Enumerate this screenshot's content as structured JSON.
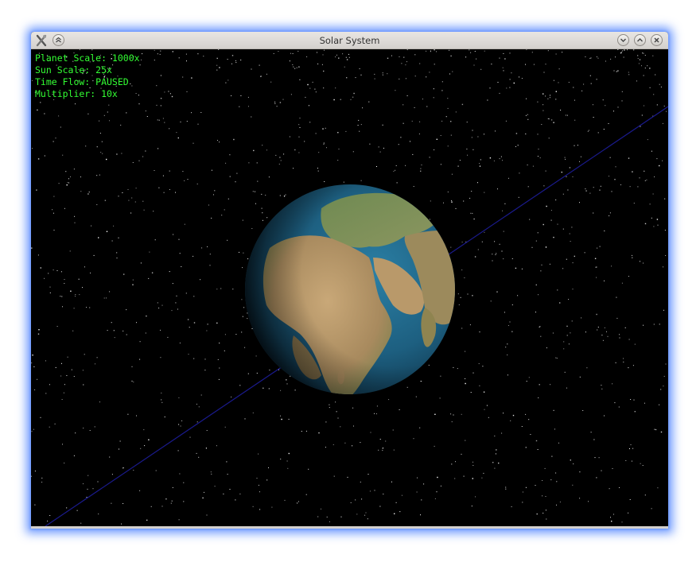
{
  "window": {
    "title": "Solar System"
  },
  "hud": {
    "planet_scale": "Planet Scale: 1000x",
    "sun_scale": "Sun Scale: 25x",
    "time_flow": "Time Flow: PAUSED",
    "multiplier": "Multiplier: 10x"
  },
  "colors": {
    "hud_text": "#33ff33",
    "orbit_line": "#1a1a8c",
    "ocean": "#1d5f80",
    "land": "#b8966a",
    "window_glow": "#5a8cff"
  },
  "icons": {
    "app": "app-tools-icon",
    "shade": "shade-up-icon",
    "minimize": "minimize-icon",
    "maximize": "maximize-icon",
    "close": "close-icon"
  }
}
